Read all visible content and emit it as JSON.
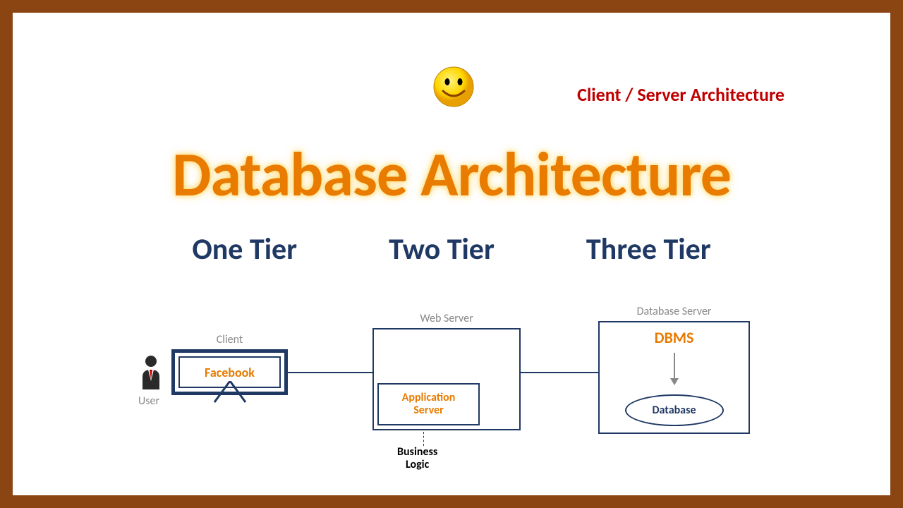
{
  "subtitle": "Client / Server Architecture",
  "main_title": "Database Architecture",
  "tiers": {
    "one": "One Tier",
    "two": "Two Tier",
    "three": "Three Tier"
  },
  "diagram": {
    "user_label": "User",
    "client": {
      "label": "Client",
      "app": "Facebook"
    },
    "web": {
      "label": "Web Server",
      "app_server": "Application\nServer",
      "business_logic": "Business\nLogic"
    },
    "database": {
      "label": "Database Server",
      "dbms": "DBMS",
      "database": "Database"
    }
  }
}
